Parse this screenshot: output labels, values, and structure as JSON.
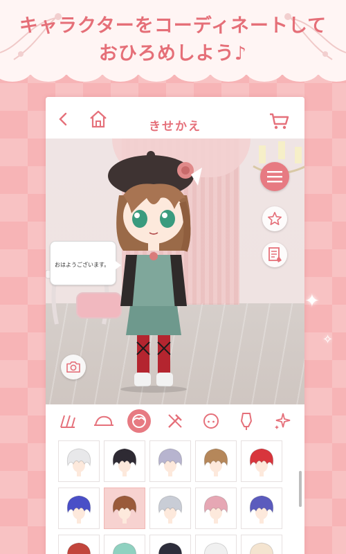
{
  "promo": {
    "headline_line1": "キャラクターをコーディネートして",
    "headline_line2": "おひろめしよう♪"
  },
  "app": {
    "title": "きせかえ",
    "back_icon": "chevron-left-icon",
    "home_icon": "home-icon",
    "cart_icon": "cart-icon"
  },
  "scene": {
    "speech_text": "おはようございます。",
    "menu_icon": "hamburger-menu-icon",
    "favorite_icon": "star-icon",
    "memo_icon": "memo-icon",
    "camera_icon": "camera-icon"
  },
  "categories": [
    {
      "name": "set",
      "icon": "clothing-set-icon",
      "active": false
    },
    {
      "name": "hat",
      "icon": "hat-icon",
      "active": false
    },
    {
      "name": "hair",
      "icon": "hair-icon",
      "active": true
    },
    {
      "name": "item",
      "icon": "tools-icon",
      "active": false
    },
    {
      "name": "face",
      "icon": "face-icon",
      "active": false
    },
    {
      "name": "outfit",
      "icon": "mannequin-icon",
      "active": false
    },
    {
      "name": "effect",
      "icon": "sparkle-icon",
      "active": false
    }
  ],
  "hair_items": [
    {
      "color": "#e8e8ea",
      "selected": false
    },
    {
      "color": "#2e2a33",
      "selected": false
    },
    {
      "color": "#b7b4cf",
      "selected": false
    },
    {
      "color": "#b5875a",
      "selected": false
    },
    {
      "color": "#d8353c",
      "selected": false
    },
    {
      "color": "#4a4fc7",
      "selected": false
    },
    {
      "color": "#9a5a3a",
      "selected": true
    },
    {
      "color": "#c9cdd6",
      "selected": false
    },
    {
      "color": "#e6a7b4",
      "selected": false
    },
    {
      "color": "#5b5bbd",
      "selected": false
    },
    {
      "color": "#c2453c",
      "selected": false
    },
    {
      "color": "#8fd1c0",
      "selected": false
    },
    {
      "color": "#2d2d3b",
      "selected": false
    },
    {
      "color": "#f0f0f0",
      "selected": false
    },
    {
      "color": "#f4e4d0",
      "selected": false
    }
  ],
  "colors": {
    "accent": "#e77a82",
    "headline": "#e56f78"
  }
}
